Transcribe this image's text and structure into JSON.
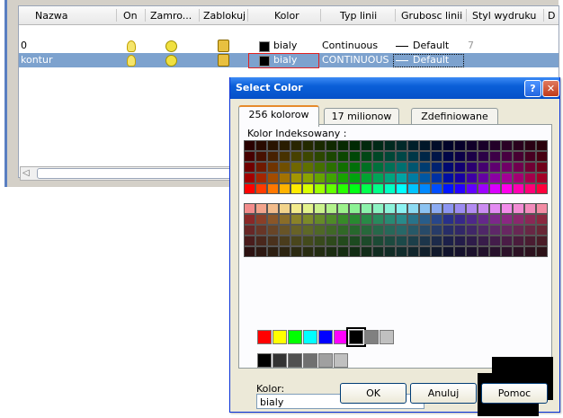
{
  "layer_table": {
    "headers": [
      "Nazwa",
      "On",
      "Zamro...",
      "Zablokuj",
      "Kolor",
      "Typ linii",
      "Grubosc linii",
      "Styl wydruku"
    ],
    "rows": [
      {
        "name": "0",
        "color": "bialy",
        "linetype": "Continuous",
        "lineweight": "Default",
        "plotstyle": "7"
      },
      {
        "name": "kontur",
        "color": "bialy",
        "linetype": "CONTINUOUS",
        "lineweight": "Default",
        "plotstyle": ""
      }
    ]
  },
  "dialog": {
    "title": "Select Color",
    "help_label": "?",
    "close_label": "✕",
    "tabs": [
      "256 kolorow",
      "17 milionow",
      "Zdefiniowane"
    ],
    "index_label": "Kolor Indeksowany :",
    "standard_colors": [
      "#ff0000",
      "#ffff00",
      "#00ff00",
      "#00ffff",
      "#0000ff",
      "#ff00ff",
      "#000000",
      "#808080",
      "#c0c0c0"
    ],
    "gray_colors": [
      "#000000",
      "#333333",
      "#505050",
      "#707070",
      "#a0a0a0",
      "#c0c0c0"
    ],
    "color_label": "Kolor:",
    "color_value": "bialy",
    "ok_label": "OK",
    "cancel_label": "Anuluj",
    "help_button_label": "Pomoc"
  }
}
